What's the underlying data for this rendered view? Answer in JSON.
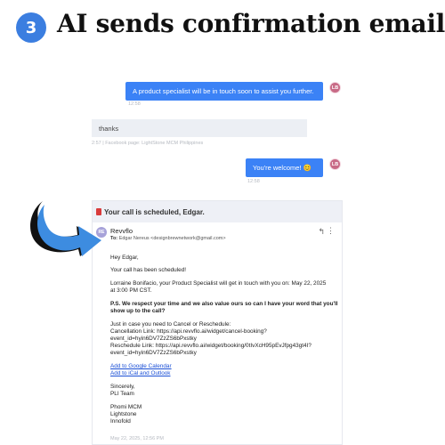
{
  "header": {
    "step_number": "3",
    "title": "AI sends confirmation email"
  },
  "chat": {
    "msg1": {
      "text": "A product specialist will be in touch soon to assist you further.",
      "avatar": "LB",
      "time": "12:58"
    },
    "msg2": {
      "text": "thanks",
      "meta": "2:57 | Facebook page: LightStone MCM Philippines"
    },
    "msg3": {
      "text": "You're welcome! 😊",
      "avatar": "LB",
      "time": "12:58"
    }
  },
  "email": {
    "subject": "Your call is scheduled, Edgar.",
    "sender_initials": "RE",
    "sender_name": "Revvflo",
    "to_label": "To:",
    "to_value": "Edgar Nereus <designbrewnetwork@gmail.com>",
    "greeting": "Hey Edgar,",
    "line_scheduled": "Your call has been scheduled!",
    "line_specialist_1": "Lorraine Bonifacio, your Product Specialist will get in touch with you on: May 22, 2025",
    "line_specialist_2": "at 3:00 PM CST.",
    "ps_1": "P.S. We respect your time and we also value ours so can I have your word that you'll",
    "ps_2": "show up to the call?",
    "reschedule_intro": "Just in case you need to Cancel or Reschedule:",
    "cancel_1": "Cancellation Link: https://api.revvflo.ai/widget/cancel-booking?",
    "cancel_2": "event_id=hyin6DV7ZzZS6bPxstky",
    "reschedule_1": "Reschedule Link: https://api.revvflo.ai/widget/booking/0tIvXcH95pEvJfpg43gt4I?",
    "reschedule_2": "event_id=hyin6DV7ZzZS6bPxstky",
    "google_calendar": "Add to Google Calendar",
    "ical_outlook": "Add to iCal and Outlook",
    "sign_1": "Sincerely,",
    "sign_2": "PLI Team",
    "company_1": "Phomi MCM",
    "company_2": "Lightstone",
    "company_3": "Innofold",
    "timestamp": "May 22, 2025, 12:56 PM"
  },
  "colors": {
    "accent": "#3b7ee0",
    "outgoing_bubble": "#3b82f6",
    "arrow": "#3d8ce0"
  },
  "icons": [
    "reply-icon",
    "more-vertical-icon",
    "mail-flag-icon",
    "curved-arrow-icon"
  ]
}
